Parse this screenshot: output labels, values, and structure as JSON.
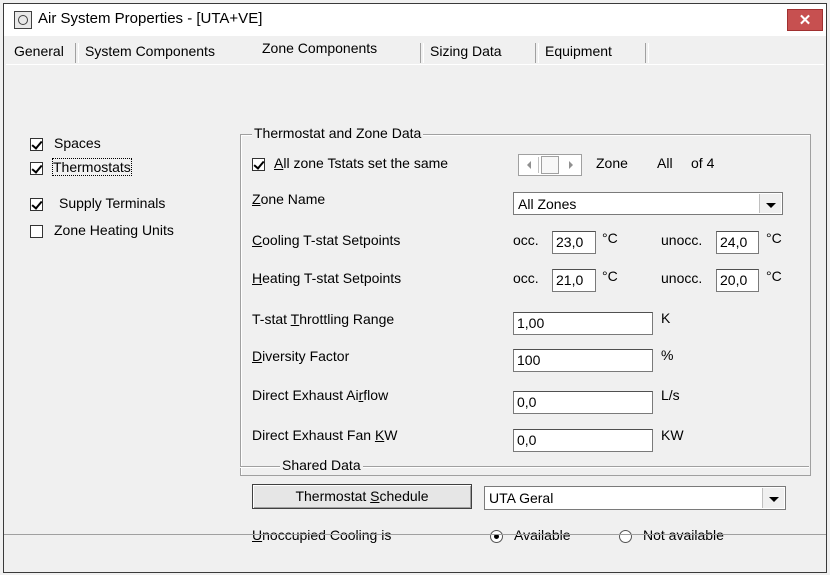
{
  "window": {
    "title": "Air System Properties - [UTA+VE]",
    "close_label": "✕"
  },
  "tabs": [
    {
      "label": "General"
    },
    {
      "label": "System Components"
    },
    {
      "label": "Zone Components"
    },
    {
      "label": "Sizing Data"
    },
    {
      "label": "Equipment"
    }
  ],
  "active_tab": "Zone Components",
  "components": [
    {
      "label": "Spaces",
      "checked": true
    },
    {
      "label": "Thermostats",
      "checked": true
    },
    {
      "label": "Supply Terminals",
      "checked": true
    },
    {
      "label": "Zone Heating Units",
      "checked": false
    }
  ],
  "thermostat_group": {
    "title": "Thermostat and Zone Data",
    "all_same": {
      "label_u": "A",
      "label_rest": "ll zone Tstats set the same",
      "checked": true
    },
    "zone_label": "Zone",
    "zone_value": "All",
    "zone_of": "of 4",
    "zone_name": {
      "label_u": "Z",
      "label_rest": "one Name",
      "value": "All Zones"
    },
    "cooling": {
      "label_u": "C",
      "label_rest": "ooling T-stat Setpoints",
      "occ_label": "occ.",
      "occ_value": "23,0",
      "unocc_label": "unocc.",
      "unocc_value": "24,0",
      "unit": "°C"
    },
    "heating": {
      "label_u": "H",
      "label_rest": "eating T-stat Setpoints",
      "occ_label": "occ.",
      "occ_value": "21,0",
      "unocc_label": "unocc.",
      "unocc_value": "20,0",
      "unit": "°C"
    },
    "throttling": {
      "label_pre": "T-stat ",
      "label_u": "T",
      "label_rest": "hrottling Range",
      "value": "1,00",
      "unit": "K"
    },
    "diversity": {
      "label_u": "D",
      "label_rest": "iversity Factor",
      "value": "100",
      "unit": "%"
    },
    "exhaust_airflow": {
      "label_pre": "Direct Exhaust Ai",
      "label_u": "r",
      "label_rest": "flow",
      "value": "0,0",
      "unit": "L/s"
    },
    "exhaust_fan": {
      "label_pre": "Direct Exhaust Fan ",
      "label_u": "K",
      "label_rest": "W",
      "value": "0,0",
      "unit": "KW"
    }
  },
  "shared_group": {
    "title": "Shared Data",
    "schedule_button": {
      "label_pre": "Thermostat ",
      "label_u": "S",
      "label_rest": "chedule"
    },
    "schedule_value": "UTA Geral",
    "unocc_cooling": {
      "label_u": "U",
      "label_rest": "noccupied Cooling is",
      "options": [
        "Available",
        "Not available"
      ],
      "selected": "Available"
    }
  }
}
